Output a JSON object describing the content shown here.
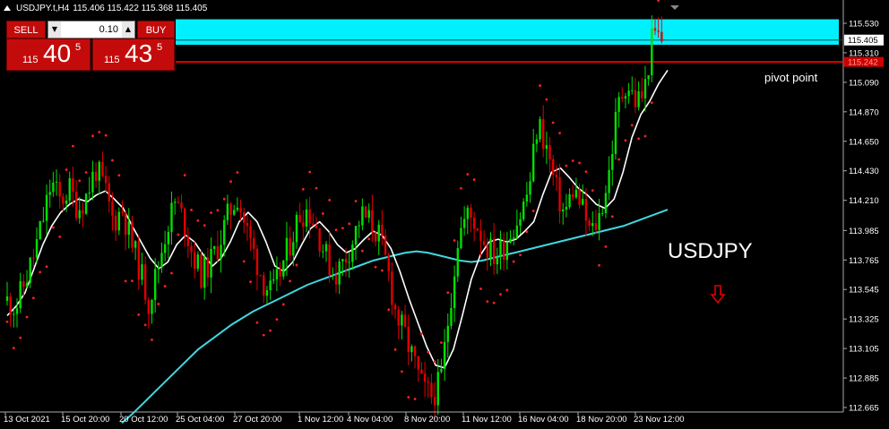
{
  "header": {
    "symbol_line": "USDJPY.t,H4",
    "ohlc": "115.406 115.422 115.368 115.405"
  },
  "trade_panel": {
    "sell_label": "SELL",
    "buy_label": "BUY",
    "lot": "0.10",
    "sell_price_prefix": "115",
    "sell_price_main": "40",
    "sell_price_sup": "5",
    "buy_price_prefix": "115",
    "buy_price_main": "43",
    "buy_price_sup": "5"
  },
  "annotations": {
    "pivot_label": "pivot point",
    "symbol_label": "USDJPY"
  },
  "colors": {
    "bull": "#00e000",
    "bear": "#e00000",
    "sma_fast": "#ffffff",
    "sma_slow": "#40d8e0",
    "sar": "#ff2020",
    "zone": "#00f0ff",
    "pivot_line": "#e00000",
    "axis_text": "#ffffff"
  },
  "chart_data": {
    "type": "candlestick",
    "symbol": "USDJPY",
    "timeframe": "H4",
    "ylim": [
      112.665,
      115.53
    ],
    "y_ticks": [
      "115.530",
      "115.310",
      "115.090",
      "114.870",
      "114.650",
      "114.430",
      "114.210",
      "113.985",
      "113.765",
      "113.545",
      "113.325",
      "113.105",
      "112.885",
      "112.665"
    ],
    "x_ticks": [
      "13 Oct 2021",
      "15 Oct 20:00",
      "20 Oct 12:00",
      "25 Oct 04:00",
      "27 Oct 20:00",
      "1 Nov 12:00",
      "4 Nov 04:00",
      "8 Nov 20:00",
      "11 Nov 12:00",
      "16 Nov 04:00",
      "18 Nov 20:00",
      "23 Nov 12:00"
    ],
    "current_price": "115.405",
    "pivot_price": "115.242",
    "pivot_point": 115.242,
    "resistance_zone": [
      115.37,
      115.56
    ],
    "close_path": [
      113.46,
      113.42,
      113.6,
      113.8,
      114.05,
      114.35,
      114.2,
      114.3,
      114.15,
      114.25,
      114.45,
      114.3,
      114.05,
      114.15,
      113.9,
      113.7,
      113.45,
      113.7,
      114.0,
      114.2,
      114.05,
      113.8,
      113.65,
      113.75,
      113.9,
      114.1,
      114.25,
      114.0,
      113.8,
      113.6,
      113.5,
      113.7,
      113.9,
      114.1,
      114.15,
      114.0,
      113.8,
      113.65,
      113.75,
      113.9,
      114.1,
      114.05,
      113.95,
      113.7,
      113.35,
      113.2,
      113.0,
      112.8,
      112.75,
      112.85,
      113.4,
      113.95,
      114.1,
      114.05,
      113.9,
      113.8,
      113.85,
      114.0,
      114.1,
      114.3,
      114.8,
      114.6,
      114.3,
      114.1,
      114.3,
      114.15,
      113.95,
      114.1,
      114.4,
      114.9,
      115.1,
      114.95,
      115.0,
      115.45,
      115.41
    ],
    "sma_fast": [
      113.35,
      113.42,
      113.52,
      113.7,
      113.88,
      114.02,
      114.12,
      114.18,
      114.22,
      114.2,
      114.25,
      114.28,
      114.22,
      114.15,
      114.02,
      113.9,
      113.78,
      113.7,
      113.75,
      113.88,
      113.95,
      113.9,
      113.8,
      113.72,
      113.78,
      113.9,
      114.05,
      114.12,
      114.05,
      113.9,
      113.72,
      113.68,
      113.75,
      113.88,
      114.0,
      114.05,
      113.98,
      113.88,
      113.82,
      113.85,
      113.92,
      113.98,
      113.95,
      113.85,
      113.68,
      113.48,
      113.3,
      113.12,
      112.98,
      112.96,
      113.1,
      113.35,
      113.62,
      113.8,
      113.9,
      113.92,
      113.9,
      113.92,
      113.98,
      114.05,
      114.25,
      114.42,
      114.45,
      114.38,
      114.3,
      114.25,
      114.18,
      114.15,
      114.22,
      114.42,
      114.68,
      114.85,
      114.95,
      115.08,
      115.18
    ],
    "sma_slow": [
      112.55,
      112.62,
      112.7,
      112.78,
      112.86,
      112.94,
      113.02,
      113.1,
      113.16,
      113.22,
      113.28,
      113.33,
      113.38,
      113.42,
      113.46,
      113.5,
      113.54,
      113.58,
      113.61,
      113.64,
      113.67,
      113.7,
      113.73,
      113.76,
      113.78,
      113.8,
      113.82,
      113.83,
      113.82,
      113.8,
      113.78,
      113.76,
      113.75,
      113.76,
      113.78,
      113.8,
      113.82,
      113.84,
      113.86,
      113.88,
      113.9,
      113.92,
      113.94,
      113.96,
      113.98,
      114.0,
      114.02,
      114.05,
      114.08,
      114.11,
      114.14
    ],
    "sar_dots": "estimated parabolic SAR dots above/below price"
  }
}
